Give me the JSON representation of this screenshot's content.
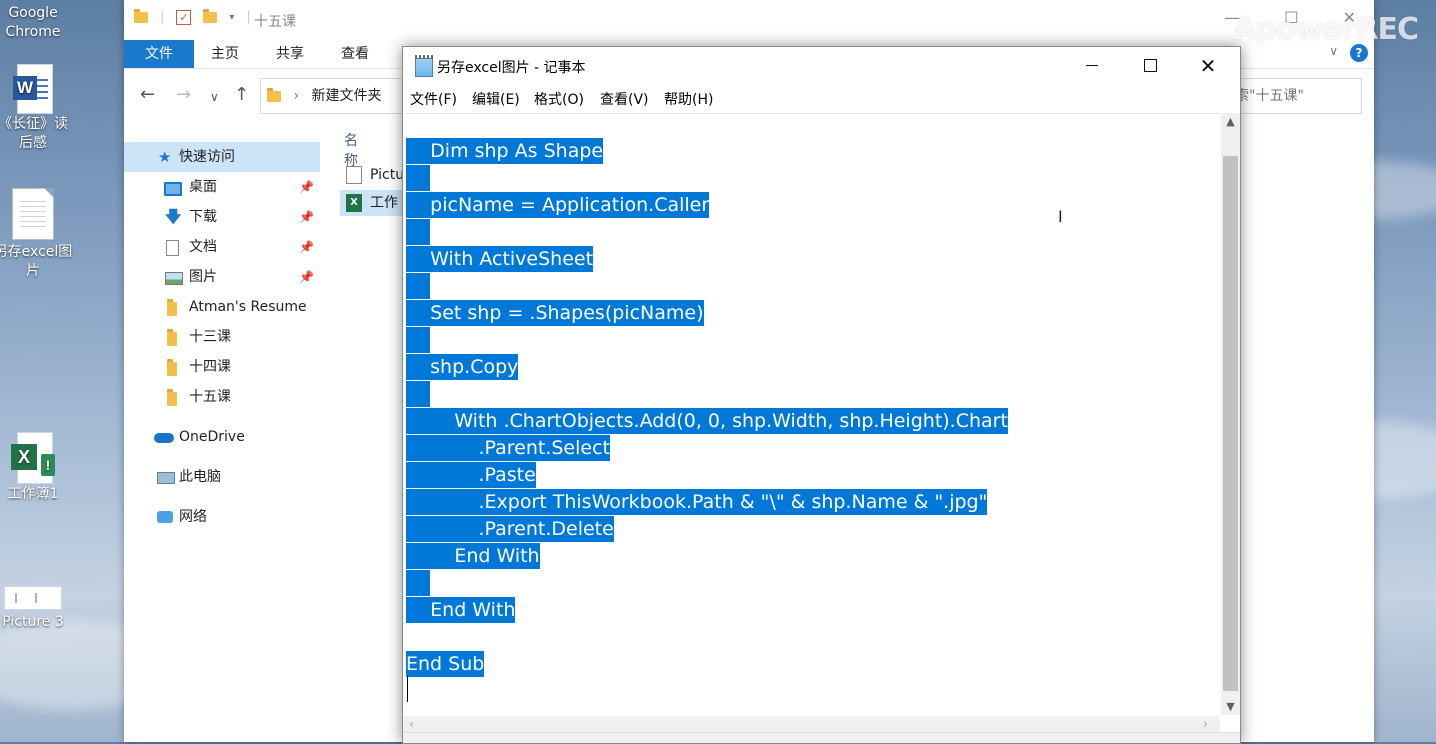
{
  "desktop": {
    "icons": [
      {
        "label": "Google Chrome"
      },
      {
        "label": "《长征》读后感"
      },
      {
        "label": "另存excel图片"
      },
      {
        "label": "工作簿1"
      },
      {
        "label": "Picture 3"
      }
    ]
  },
  "watermark": "ApowerREC",
  "explorer": {
    "title": "十五课",
    "ribbon_tabs": [
      "文件",
      "主页",
      "共享",
      "查看"
    ],
    "breadcrumb": "新建文件夹",
    "search_placeholder": "搜索\"十五课\"",
    "help": "?",
    "nav": {
      "quick_access": "快速访问",
      "items": [
        {
          "label": "桌面",
          "pinned": true
        },
        {
          "label": "下载",
          "pinned": true
        },
        {
          "label": "文档",
          "pinned": true
        },
        {
          "label": "图片",
          "pinned": true
        },
        {
          "label": "Atman's Resume",
          "pinned": false
        },
        {
          "label": "十三课",
          "pinned": false
        },
        {
          "label": "十四课",
          "pinned": false
        },
        {
          "label": "十五课",
          "pinned": false
        }
      ],
      "onedrive": "OneDrive",
      "this_pc": "此电脑",
      "network": "网络"
    },
    "column_name": "名称",
    "files": [
      {
        "name": "Pictu",
        "type": "picture"
      },
      {
        "name": "工作",
        "type": "excel"
      }
    ]
  },
  "notepad": {
    "title": "另存excel图片 - 记事本",
    "menu": [
      "文件(F)",
      "编辑(E)",
      "格式(O)",
      "查看(V)",
      "帮助(H)"
    ],
    "code_lines": [
      {
        "text": "    Dim shp As Shape",
        "selected": true
      },
      {
        "text": "    ",
        "selected": true
      },
      {
        "text": "    picName = Application.Caller",
        "selected": true
      },
      {
        "text": "    ",
        "selected": true
      },
      {
        "text": "    With ActiveSheet",
        "selected": true
      },
      {
        "text": "    ",
        "selected": true
      },
      {
        "text": "    Set shp = .Shapes(picName)",
        "selected": true
      },
      {
        "text": "    ",
        "selected": true
      },
      {
        "text": "    shp.Copy",
        "selected": true
      },
      {
        "text": "    ",
        "selected": true
      },
      {
        "text": "        With .ChartObjects.Add(0, 0, shp.Width, shp.Height).Chart",
        "selected": true
      },
      {
        "text": "            .Parent.Select",
        "selected": true
      },
      {
        "text": "            .Paste",
        "selected": true
      },
      {
        "text": "            .Export ThisWorkbook.Path & \"\\\" & shp.Name & \".jpg\"",
        "selected": true
      },
      {
        "text": "            .Parent.Delete",
        "selected": true
      },
      {
        "text": "        End With",
        "selected": true
      },
      {
        "text": "    ",
        "selected": true
      },
      {
        "text": "    End With",
        "selected": true
      },
      {
        "text": "",
        "selected": false
      },
      {
        "text": "End Sub",
        "selected": true
      },
      {
        "text": "",
        "selected": false
      }
    ],
    "selection_color": "#0078d7"
  }
}
